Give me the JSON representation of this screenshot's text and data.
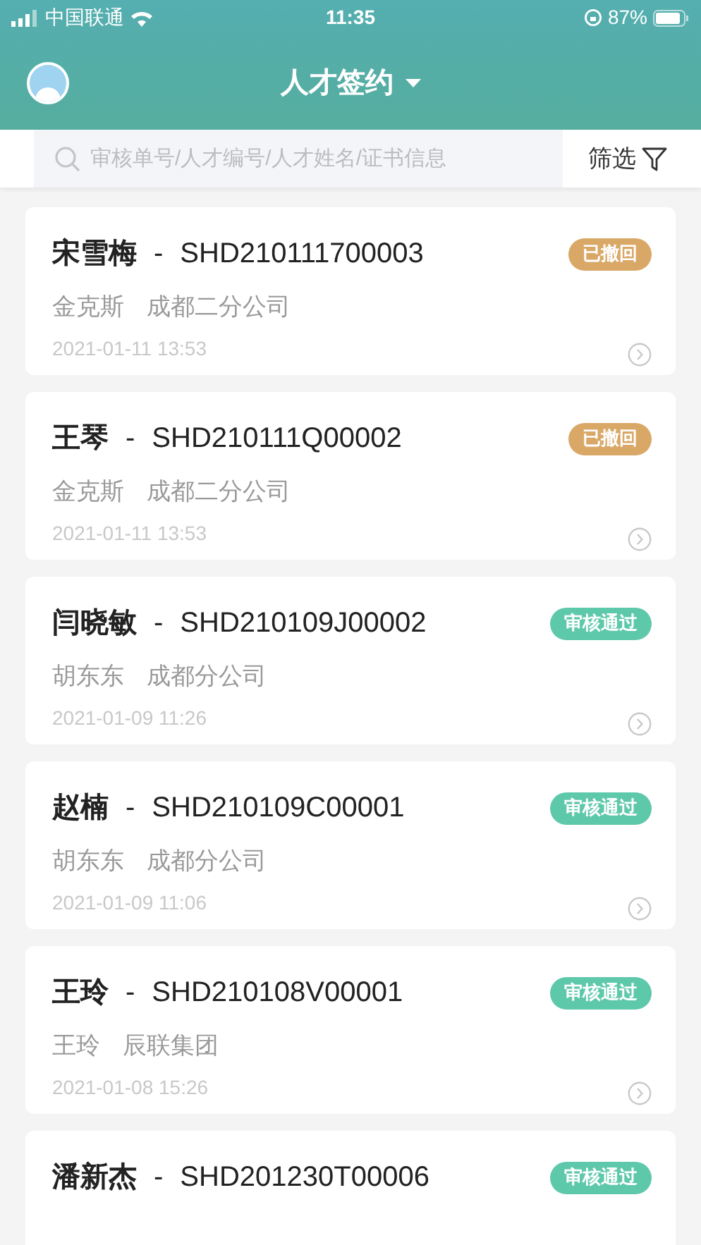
{
  "status_bar": {
    "carrier": "中国联通",
    "time": "11:35",
    "battery": "87%"
  },
  "header": {
    "title": "人才签约"
  },
  "search": {
    "placeholder": "审核单号/人才编号/人才姓名/证书信息"
  },
  "filter": {
    "label": "筛选"
  },
  "records": [
    {
      "name": "宋雪梅",
      "separator": "-",
      "code": "SHD210111700003",
      "status": "已撤回",
      "color": "#d9a867",
      "agent": "金克斯",
      "company": "成都二分公司",
      "time": "2021-01-11 13:53"
    },
    {
      "name": "王琴",
      "separator": "-",
      "code": "SHD210111Q00002",
      "status": "已撤回",
      "color": "#d9a867",
      "agent": "金克斯",
      "company": "成都二分公司",
      "time": "2021-01-11 13:53"
    },
    {
      "name": "闫晓敏",
      "separator": "-",
      "code": "SHD210109J00002",
      "status": "审核通过",
      "color": "#5ec8aa",
      "agent": "胡东东",
      "company": "成都分公司",
      "time": "2021-01-09 11:26"
    },
    {
      "name": "赵楠",
      "separator": "-",
      "code": "SHD210109C00001",
      "status": "审核通过",
      "color": "#5ec8aa",
      "agent": "胡东东",
      "company": "成都分公司",
      "time": "2021-01-09 11:06"
    },
    {
      "name": "王玲",
      "separator": "-",
      "code": "SHD210108V00001",
      "status": "审核通过",
      "color": "#5ec8aa",
      "agent": "王玲",
      "company": "辰联集团",
      "time": "2021-01-08 15:26"
    },
    {
      "name": "潘新杰",
      "separator": "-",
      "code": "SHD201230T00006",
      "status": "审核通过",
      "color": "#5ec8aa"
    }
  ]
}
